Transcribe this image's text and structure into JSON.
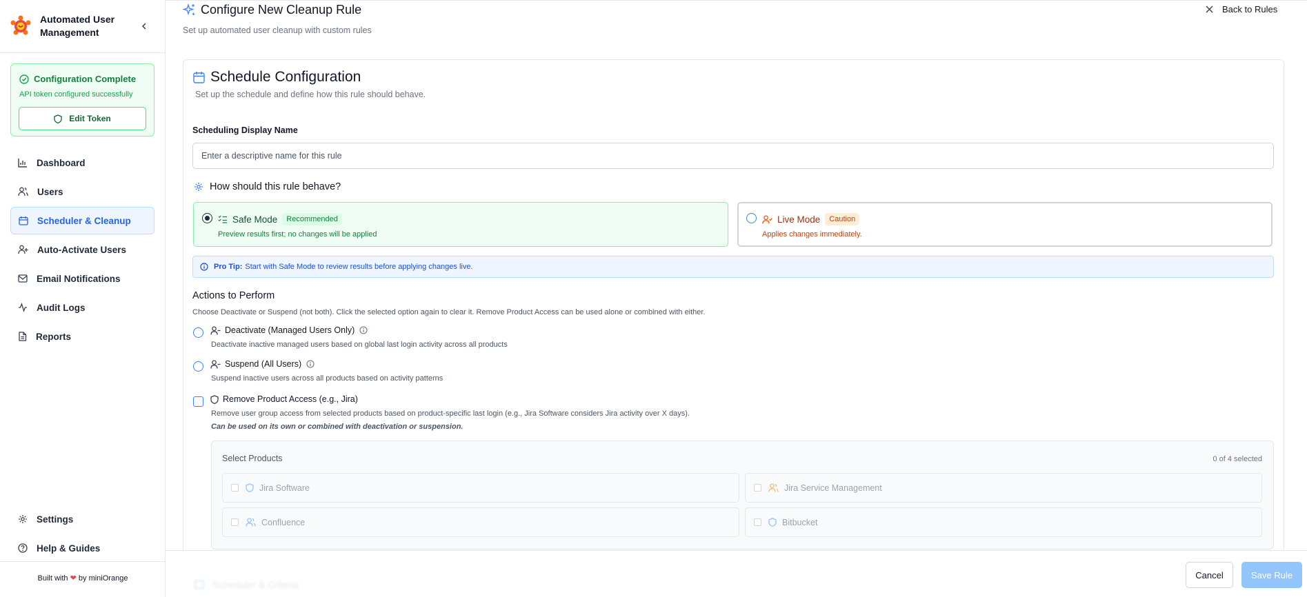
{
  "sidebar": {
    "brand": "Automated User Management",
    "config": {
      "title": "Configuration Complete",
      "subtitle": "API token configured successfully",
      "edit_label": "Edit Token"
    },
    "nav": [
      {
        "label": "Dashboard",
        "icon": "bar-chart-icon"
      },
      {
        "label": "Users",
        "icon": "users-icon"
      },
      {
        "label": "Scheduler & Cleanup",
        "icon": "calendar-icon",
        "active": true
      },
      {
        "label": "Auto-Activate Users",
        "icon": "user-plus-icon"
      },
      {
        "label": "Email Notifications",
        "icon": "mail-icon"
      },
      {
        "label": "Audit Logs",
        "icon": "activity-icon"
      },
      {
        "label": "Reports",
        "icon": "file-text-icon"
      }
    ],
    "bottom_nav": [
      {
        "label": "Settings",
        "icon": "gear-icon"
      },
      {
        "label": "Help & Guides",
        "icon": "help-circle-icon"
      }
    ],
    "built_prefix": "Built with",
    "built_suffix": "by miniOrange"
  },
  "header": {
    "title": "Configure New Cleanup Rule",
    "subtitle": "Set up automated user cleanup with custom rules",
    "back_label": "Back to Rules"
  },
  "schedule": {
    "title": "Schedule Configuration",
    "subtitle": "Set up the schedule and define how this rule should behave.",
    "name_label": "Scheduling Display Name",
    "name_placeholder": "Enter a descriptive name for this rule",
    "name_value": "",
    "behave_title": "How should this rule behave?",
    "safe": {
      "label": "Safe Mode",
      "badge": "Recommended",
      "desc": "Preview results first; no changes will be applied",
      "selected": true
    },
    "live": {
      "label": "Live Mode",
      "badge": "Caution",
      "desc": "Applies changes immediately.",
      "selected": false
    },
    "tip_bold": "Pro Tip:",
    "tip_text": "Start with Safe Mode to review results before applying changes live."
  },
  "actions": {
    "title": "Actions to Perform",
    "subtitle": "Choose Deactivate or Suspend (not both). Click the selected option again to clear it. Remove Product Access can be used alone or combined with either.",
    "deactivate": {
      "label": "Deactivate (Managed Users Only)",
      "desc": "Deactivate inactive managed users based on global last login activity across all products"
    },
    "suspend": {
      "label": "Suspend (All Users)",
      "desc": "Suspend inactive users across all products based on activity patterns"
    },
    "remove": {
      "label": "Remove Product Access (e.g., Jira)",
      "desc": "Remove user group access from selected products based on product-specific last login (e.g., Jira Software considers Jira activity over X days).",
      "note": "Can be used on its own or combined with deactivation or suspension."
    }
  },
  "products": {
    "title": "Select Products",
    "count": "0 of 4 selected",
    "items": [
      {
        "label": "Jira Software",
        "icon": "shield-icon"
      },
      {
        "label": "Jira Service Management",
        "icon": "users-icon"
      },
      {
        "label": "Confluence",
        "icon": "users-icon"
      },
      {
        "label": "Bitbucket",
        "icon": "shield-icon"
      }
    ]
  },
  "footer": {
    "cancel_label": "Cancel",
    "save_label": "Save Rule",
    "faded_text": "Scheduler & Criteria"
  },
  "colors": {
    "accent": "#2563eb",
    "success": "#15803d",
    "warning": "#c2410c",
    "save_disabled": "#93c5fd"
  }
}
